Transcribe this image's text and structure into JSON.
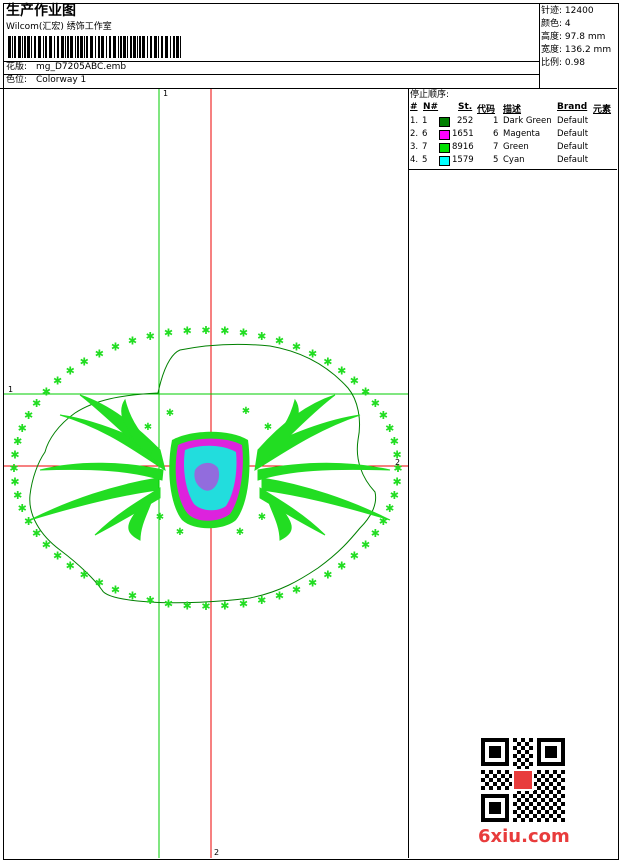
{
  "header": {
    "title": "生产作业图",
    "company": "Wilcom(汇宏) 绣饰工作室",
    "design_label": "花版:",
    "design_value": "mg_D7205ABC.emb",
    "colorway_label": "色位:",
    "colorway_value": "Colorway 1"
  },
  "stats": [
    {
      "label": "针迹:",
      "value": "12400"
    },
    {
      "label": "颜色:",
      "value": "4"
    },
    {
      "label": "高度:",
      "value": "97.8 mm"
    },
    {
      "label": "宽度:",
      "value": "136.2 mm"
    },
    {
      "label": "比例:",
      "value": "0.98"
    }
  ],
  "stop_sequence": {
    "title": "停止顺序:",
    "columns": [
      "#",
      "N#",
      "St.",
      "代码",
      "描述",
      "Brand",
      "元素"
    ],
    "rows": [
      {
        "idx": "1.",
        "n": "1",
        "color": "#008000",
        "stitches": "252",
        "code": "1",
        "desc": "Dark Green",
        "brand": "Default"
      },
      {
        "idx": "2.",
        "n": "6",
        "color": "#ff00ff",
        "stitches": "1651",
        "code": "6",
        "desc": "Magenta",
        "brand": "Default"
      },
      {
        "idx": "3.",
        "n": "7",
        "color": "#00e000",
        "stitches": "8916",
        "code": "7",
        "desc": "Green",
        "brand": "Default"
      },
      {
        "idx": "4.",
        "n": "5",
        "color": "#00ffff",
        "stitches": "1579",
        "code": "5",
        "desc": "Cyan",
        "brand": "Default"
      }
    ]
  },
  "axes": {
    "top_label": "1",
    "left_label": "1",
    "right_label": "2",
    "bottom_label": "2"
  },
  "watermark": {
    "text": "6xiu.com"
  },
  "colors": {
    "dark_green": "#008000",
    "green": "#22dd22",
    "magenta": "#dd22dd",
    "cyan": "#22dddd",
    "guide_green": "#00cc00",
    "guide_red": "#ee0000",
    "watermark_red": "#e83c3c"
  }
}
